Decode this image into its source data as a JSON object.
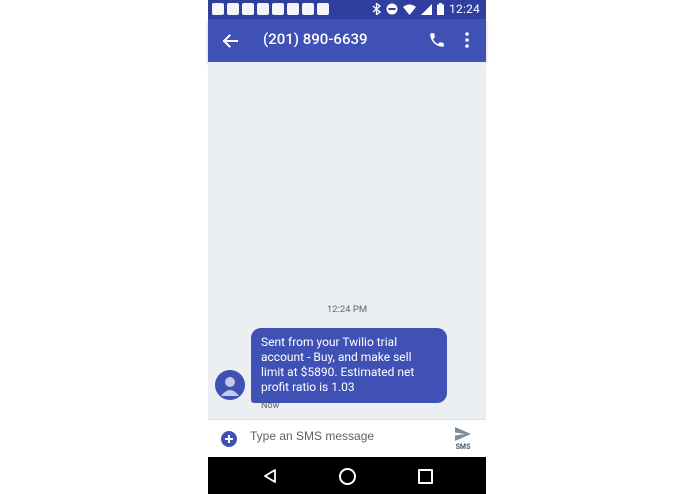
{
  "status_bar": {
    "time": "12:24",
    "icons_left": [
      "hangouts-icon",
      "facebook-icon",
      "youtube-icon",
      "vpn-icon",
      "gmail-icon",
      "gmail-icon",
      "gmail-icon",
      "sms-icon"
    ],
    "icons_right": [
      "bluetooth-icon",
      "do-not-disturb-icon",
      "wifi-icon",
      "signal-icon",
      "battery-icon"
    ]
  },
  "header": {
    "title": "(201) 890-6639",
    "back_icon": "arrow-back-icon",
    "call_icon": "phone-icon",
    "more_icon": "more-vert-icon"
  },
  "thread": {
    "timestamp": "12:24 PM",
    "messages": [
      {
        "text": "Sent from your Twilio trial account - Buy, and make sell limit at $5890. Estimated net profit ratio is 1.03",
        "meta": "Now",
        "avatar": "person-icon"
      }
    ]
  },
  "composer": {
    "placeholder": "Type an SMS message",
    "send_label": "SMS",
    "add_icon": "add-circle-icon",
    "send_icon": "send-icon"
  },
  "nav_bar": {
    "icons": [
      "nav-back-icon",
      "nav-home-icon",
      "nav-recents-icon"
    ]
  },
  "colors": {
    "primary": "#3f51b5",
    "primary_dark": "#303f9f",
    "thread_bg": "#eceff1"
  }
}
